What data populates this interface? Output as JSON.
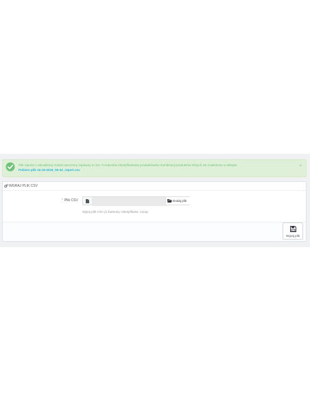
{
  "colors": {
    "success_bg": "#dff0d8",
    "success_icon": "#72c279",
    "link": "#27b4d8",
    "required": "#e08f95"
  },
  "alert": {
    "message": "Plik raportu z aktualizacji został utworzony zapisany w mm ?! reductów identyfikatorów produktów/lun kombinacji produktów których nie znaleziono w sklepie.",
    "link_text": "Pobierz plik 15-19-2018_09-42_report.csv",
    "close": "×",
    "icon": "check-circle-icon"
  },
  "panel": {
    "title": "WGRAJ PLIK CSV",
    "icon": "cogs-icon"
  },
  "form": {
    "required_mark": "*",
    "label": "Plik CSV",
    "file_value": "",
    "choose_button": "Dodaj plik",
    "help": "Wgraj plik CSV (2 kolumny: identyfikator, cena)"
  },
  "footer": {
    "submit_label": "Wgraj plik",
    "submit_icon": "save-icon"
  }
}
